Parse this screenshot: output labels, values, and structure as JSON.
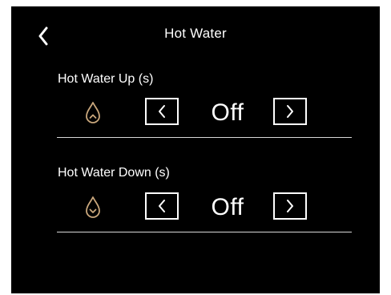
{
  "header": {
    "title": "Hot Water",
    "back_icon": "chevron-left-icon"
  },
  "settings": [
    {
      "label": "Hot Water Up (s)",
      "value": "Off",
      "icon": "water-drop-up-icon"
    },
    {
      "label": "Hot Water Down (s)",
      "value": "Off",
      "icon": "water-drop-down-icon"
    }
  ],
  "colors": {
    "background": "#000000",
    "text": "#ffffff",
    "accent": "#c9a77c",
    "divider": "#d8d8d8"
  }
}
